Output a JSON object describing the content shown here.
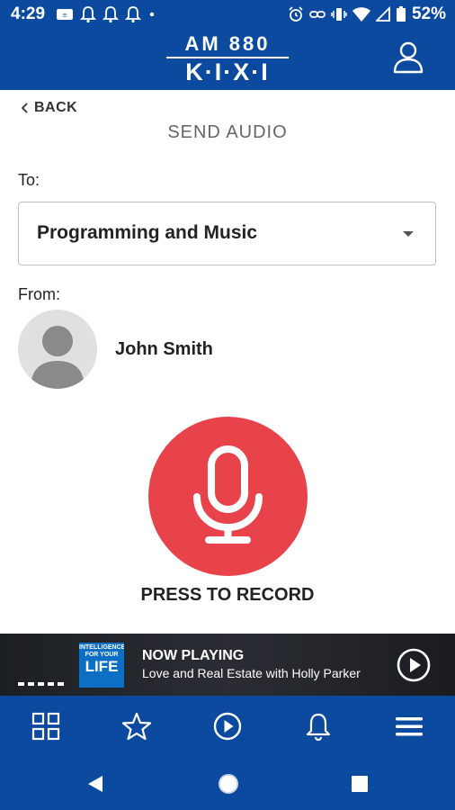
{
  "status_bar": {
    "time": "4:29",
    "battery": "52%"
  },
  "header": {
    "logo_top": "AM 880",
    "logo_bottom": "K·I·X·I"
  },
  "nav": {
    "back_label": "BACK"
  },
  "page": {
    "title": "SEND AUDIO",
    "to_label": "To:",
    "to_value": "Programming and Music",
    "from_label": "From:",
    "sender_name": "John Smith",
    "record_label": "PRESS TO RECORD"
  },
  "now_playing": {
    "heading": "NOW PLAYING",
    "title": "Love and Real Estate with Holly Parker",
    "art_text_top": "INTELLIGENCE",
    "art_text_mid": "FOR YOUR",
    "art_text_big": "LIFE"
  },
  "colors": {
    "brand_blue": "#0c4aa0",
    "record_red": "#e8424a"
  },
  "bottom_nav": {
    "items": [
      "home-grid-icon",
      "favorites-star-icon",
      "play-icon",
      "notifications-bell-icon",
      "menu-icon"
    ]
  }
}
